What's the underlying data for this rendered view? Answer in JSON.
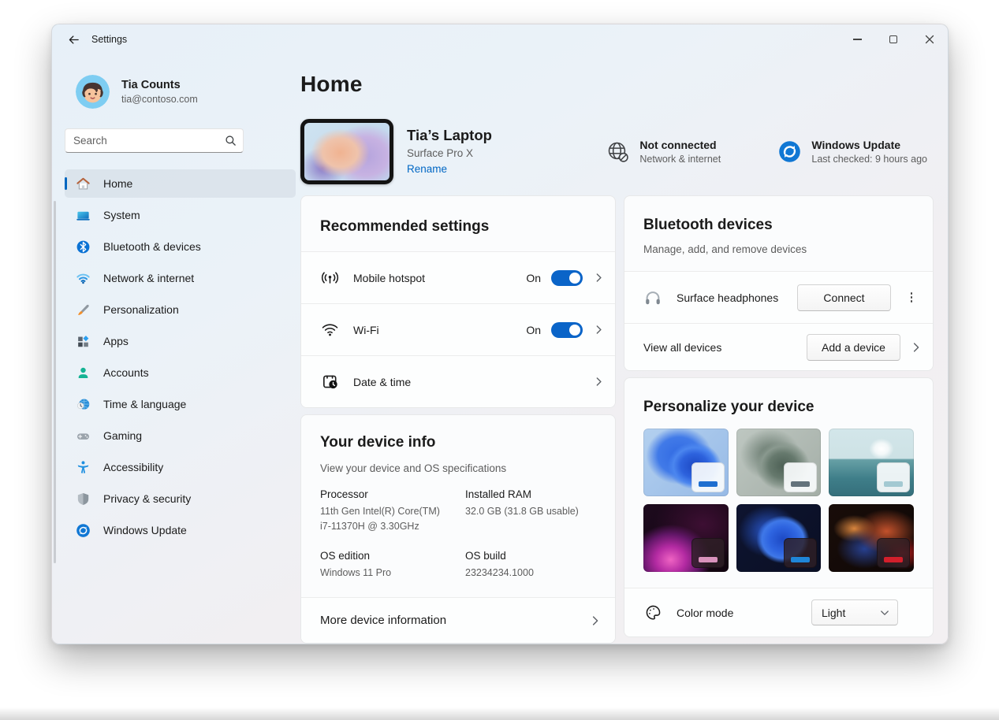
{
  "titlebar": {
    "app_title": "Settings"
  },
  "profile": {
    "name": "Tia Counts",
    "email": "tia@contoso.com"
  },
  "search": {
    "placeholder": "Search"
  },
  "sidebar": {
    "items": [
      {
        "label": "Home",
        "icon": "home-icon",
        "selected": true
      },
      {
        "label": "System",
        "icon": "system-icon"
      },
      {
        "label": "Bluetooth & devices",
        "icon": "bluetooth-icon"
      },
      {
        "label": "Network & internet",
        "icon": "network-icon"
      },
      {
        "label": "Personalization",
        "icon": "personalization-icon"
      },
      {
        "label": "Apps",
        "icon": "apps-icon"
      },
      {
        "label": "Accounts",
        "icon": "accounts-icon"
      },
      {
        "label": "Time & language",
        "icon": "time-language-icon"
      },
      {
        "label": "Gaming",
        "icon": "gaming-icon"
      },
      {
        "label": "Accessibility",
        "icon": "accessibility-icon"
      },
      {
        "label": "Privacy & security",
        "icon": "privacy-icon"
      },
      {
        "label": "Windows Update",
        "icon": "windows-update-icon"
      }
    ]
  },
  "page": {
    "title": "Home"
  },
  "device": {
    "name": "Tia’s Laptop",
    "model": "Surface Pro X",
    "rename_label": "Rename"
  },
  "status_tiles": [
    {
      "title": "Not connected",
      "subtitle": "Network & internet",
      "icon": "globe-offline-icon"
    },
    {
      "title": "Windows Update",
      "subtitle": "Last checked: 9 hours ago",
      "icon": "windows-update-icon"
    }
  ],
  "recommended": {
    "title": "Recommended settings",
    "rows": [
      {
        "label": "Mobile hotspot",
        "state": "On",
        "icon": "hotspot-icon"
      },
      {
        "label": "Wi-Fi",
        "state": "On",
        "icon": "wifi-icon"
      },
      {
        "label": "Date & time",
        "icon": "datetime-icon"
      }
    ]
  },
  "device_info": {
    "title": "Your device info",
    "subtitle": "View your device and OS specifications",
    "specs": [
      {
        "label": "Processor",
        "value": "11th Gen Intel(R) Core(TM)\ni7-11370H @ 3.30GHz"
      },
      {
        "label": "Installed RAM",
        "value": "32.0 GB (31.8 GB usable)"
      },
      {
        "label": "OS edition",
        "value": "Windows 11 Pro"
      },
      {
        "label": "OS build",
        "value": "23234234.1000"
      }
    ],
    "more_label": "More device information"
  },
  "bluetooth": {
    "title": "Bluetooth devices",
    "subtitle": "Manage, add, and remove devices",
    "device_row": {
      "name": "Surface headphones",
      "button": "Connect",
      "icon": "headphones-icon"
    },
    "footer_row": {
      "label": "View all devices",
      "button": "Add a device"
    }
  },
  "personalize": {
    "title": "Personalize your device",
    "themes": [
      {
        "name": "windows-bloom-light",
        "overlay": "light",
        "accent": "#1f6fd0"
      },
      {
        "name": "sage-bloom-light",
        "overlay": "light",
        "accent": "#64737c"
      },
      {
        "name": "sunrise-beach-light",
        "overlay": "light",
        "accent": "#a3c9d2"
      },
      {
        "name": "purple-crescent-dark",
        "overlay": "dark",
        "accent": "#d992bc"
      },
      {
        "name": "windows-bloom-dark",
        "overlay": "dark",
        "accent": "#1f86d8"
      },
      {
        "name": "abstract-flow-dark",
        "overlay": "dark",
        "accent": "#d31f2b"
      }
    ],
    "color_mode": {
      "label": "Color mode",
      "value": "Light",
      "icon": "palette-icon"
    }
  },
  "colors": {
    "accent": "#0067c0",
    "link": "#0067c4",
    "toggle_on": "#0a64c8"
  }
}
